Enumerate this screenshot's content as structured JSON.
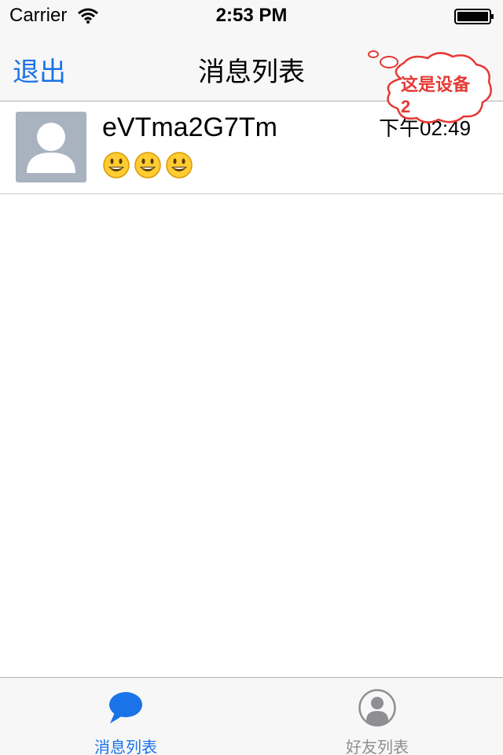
{
  "status_bar": {
    "carrier": "Carrier",
    "time": "2:53 PM"
  },
  "nav": {
    "back_label": "退出",
    "title": "消息列表"
  },
  "messages": [
    {
      "name": "eVTma2G7Tm",
      "time": "下午02:49",
      "preview_emojis": [
        "smiley-emoji",
        "smiley-emoji",
        "smiley-emoji"
      ]
    }
  ],
  "annotation": {
    "text": "这是设备2"
  },
  "tabs": [
    {
      "label": "消息列表",
      "icon": "chat-bubble-icon",
      "active": true
    },
    {
      "label": "好友列表",
      "icon": "contact-icon",
      "active": false
    }
  ],
  "colors": {
    "accent": "#1a73e8",
    "annotation": "#e53935"
  }
}
